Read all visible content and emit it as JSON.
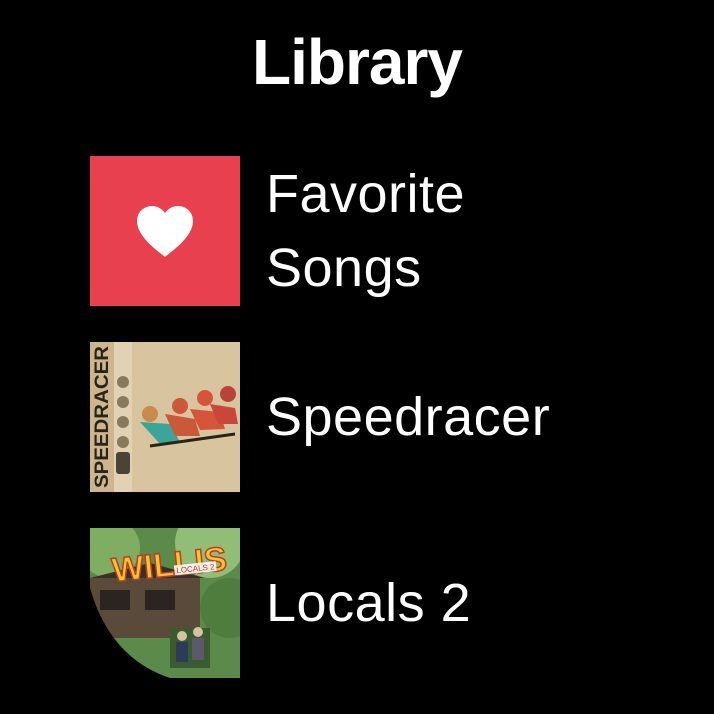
{
  "header": {
    "title": "Library"
  },
  "items": [
    {
      "label": "Favorite Songs",
      "artwork": "heart-icon",
      "color": "#e8404f"
    },
    {
      "label": "Speedracer",
      "artwork": "album-art-speedracer",
      "art_text": "SPEEDRACER",
      "color": "#d7c09c"
    },
    {
      "label": "Locals 2",
      "artwork": "album-art-locals",
      "art_text": "WILLIS",
      "art_subtext": "LOCALS 2",
      "color": "#3e6b37"
    }
  ]
}
